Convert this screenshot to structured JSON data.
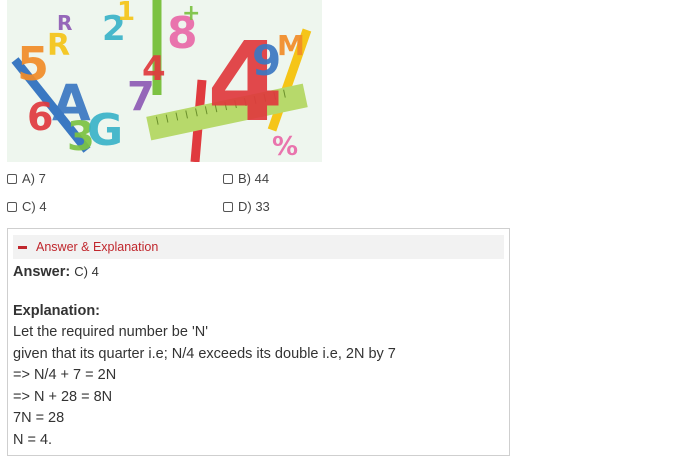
{
  "options": [
    {
      "label": "A) 7"
    },
    {
      "label": "B) 44"
    },
    {
      "label": "C) 4"
    },
    {
      "label": "D) 33"
    }
  ],
  "panel": {
    "header_label": "Answer & Explanation",
    "answer_label": "Answer:",
    "answer_value": "C) 4",
    "explanation_label": "Explanation:",
    "explanation_lines": [
      "Let the required number be 'N'",
      "given that its quarter i.e; N/4 exceeds its double i.e, 2N by 7",
      "=> N/4 + 7 = 2N",
      "=> N + 28 = 8N",
      "7N = 28",
      "N = 4."
    ]
  },
  "illustration": {
    "glyphs": [
      "4",
      "5",
      "2",
      "8",
      "7",
      "R",
      "3",
      "9",
      "6",
      "M",
      "G",
      "%",
      "R",
      "1",
      "+",
      "A",
      "4"
    ],
    "colors": {
      "background": "#eef6ee",
      "red": "#e03a3e",
      "orange": "#f28c28",
      "yellow": "#f5c518",
      "green": "#7cc242",
      "teal": "#3bb3c9",
      "blue": "#3a78c2",
      "purple": "#8e5bb5",
      "pink": "#e96aa8"
    }
  },
  "colors": {
    "accent": "#c0272d",
    "panel_border": "#cfcfcf",
    "panel_header_bg": "#f2f2f2",
    "text": "#333333"
  }
}
